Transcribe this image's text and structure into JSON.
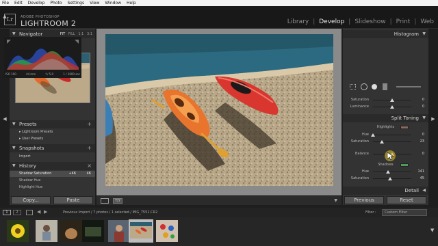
{
  "menu": [
    "File",
    "Edit",
    "Develop",
    "Photo",
    "Settings",
    "View",
    "Window",
    "Help"
  ],
  "identity": {
    "badge": "Lr",
    "subtitle": "ADOBE PHOTOSHOP",
    "title": "LIGHTROOM 2"
  },
  "modules": [
    {
      "label": "Library",
      "active": false
    },
    {
      "label": "Develop",
      "active": true
    },
    {
      "label": "Slideshow",
      "active": false
    },
    {
      "label": "Print",
      "active": false
    },
    {
      "label": "Web",
      "active": false
    }
  ],
  "left": {
    "navigator": {
      "title": "Navigator",
      "options": [
        "FIT",
        "FILL",
        "1:1",
        "3:1"
      ]
    },
    "presets": {
      "title": "Presets",
      "items": [
        "Lightroom Presets",
        "User Presets"
      ]
    },
    "snapshots": {
      "title": "Snapshots",
      "items": [
        "Import"
      ]
    },
    "history": {
      "title": "History",
      "rows": [
        {
          "name": "Shadow Saturation",
          "a": "+46",
          "b": "46"
        },
        {
          "name": "Shadow Hue",
          "a": "",
          "b": ""
        },
        {
          "name": "Highlight Hue",
          "a": "",
          "b": ""
        }
      ]
    },
    "copy_label": "Copy...",
    "paste_label": "Paste"
  },
  "right": {
    "histogram": {
      "title": "Histogram",
      "info": [
        "ISO 100",
        "44 mm",
        "f / 5.0",
        "1 / 2000 sec"
      ]
    },
    "hsl_sliders": [
      {
        "label": "Saturation",
        "value": "0",
        "pos": 0.5
      },
      {
        "label": "Luminance",
        "value": "0",
        "pos": 0.5
      }
    ],
    "split_toning": {
      "title": "Split Toning",
      "highlights_label": "Highlights",
      "highlights_color": "#8a6a5a",
      "highlight_sliders": [
        {
          "label": "Hue",
          "value": "0",
          "pos": 0.0
        },
        {
          "label": "Saturation",
          "value": "23",
          "pos": 0.23
        }
      ],
      "balance": {
        "label": "Balance",
        "value": "0",
        "pos": 0.5
      },
      "shadows_label": "Shadows",
      "shadows_color": "#4f9a5a",
      "shadow_sliders": [
        {
          "label": "Hue",
          "value": "141",
          "pos": 0.39
        },
        {
          "label": "Saturation",
          "value": "45",
          "pos": 0.45
        }
      ]
    },
    "detail_title": "Detail",
    "previous_label": "Previous",
    "reset_label": "Reset"
  },
  "filmstrip": {
    "pages": [
      "1",
      "2"
    ],
    "info": "Previous Import / 7 photos / 1 selected / IMG_7551.CR2",
    "filter_label": "Filter :",
    "filter_value": "Custom Filter",
    "selected_index": 5,
    "thumb_count": 7
  }
}
